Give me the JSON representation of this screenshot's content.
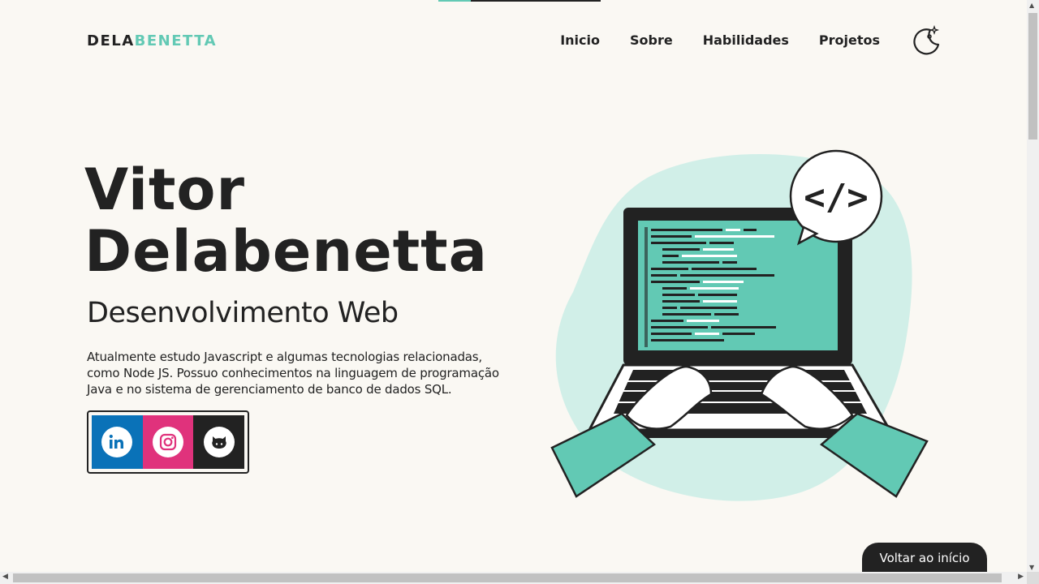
{
  "header": {
    "logo_part1": "DELA",
    "logo_part2": "BENETTA",
    "nav": [
      "Inicio",
      "Sobre",
      "Habilidades",
      "Projetos"
    ],
    "theme_toggle_icon": "moon-sparkle-icon"
  },
  "hero": {
    "name_line1": "Vitor",
    "name_line2": "Delabenetta",
    "role": "Desenvolvimento Web",
    "description": "Atualmente estudo Javascript e algumas tecnologias relacionadas, como Node JS. Possuo conhecimentos na linguagem de programação Java e no sistema de gerenciamento de banco de dados SQL."
  },
  "social": [
    {
      "name": "linkedin",
      "icon": "linkedin-icon",
      "color": "#0a72b8"
    },
    {
      "name": "instagram",
      "icon": "instagram-icon",
      "color": "#e0327c"
    },
    {
      "name": "github",
      "icon": "github-icon",
      "color": "#222222"
    }
  ],
  "illustration": {
    "icon": "developer-laptop-illustration",
    "badge_text": "</>"
  },
  "back_to_top": "Voltar ao início",
  "colors": {
    "accent": "#62c9b4",
    "dark": "#222222",
    "background": "#faf8f3"
  }
}
